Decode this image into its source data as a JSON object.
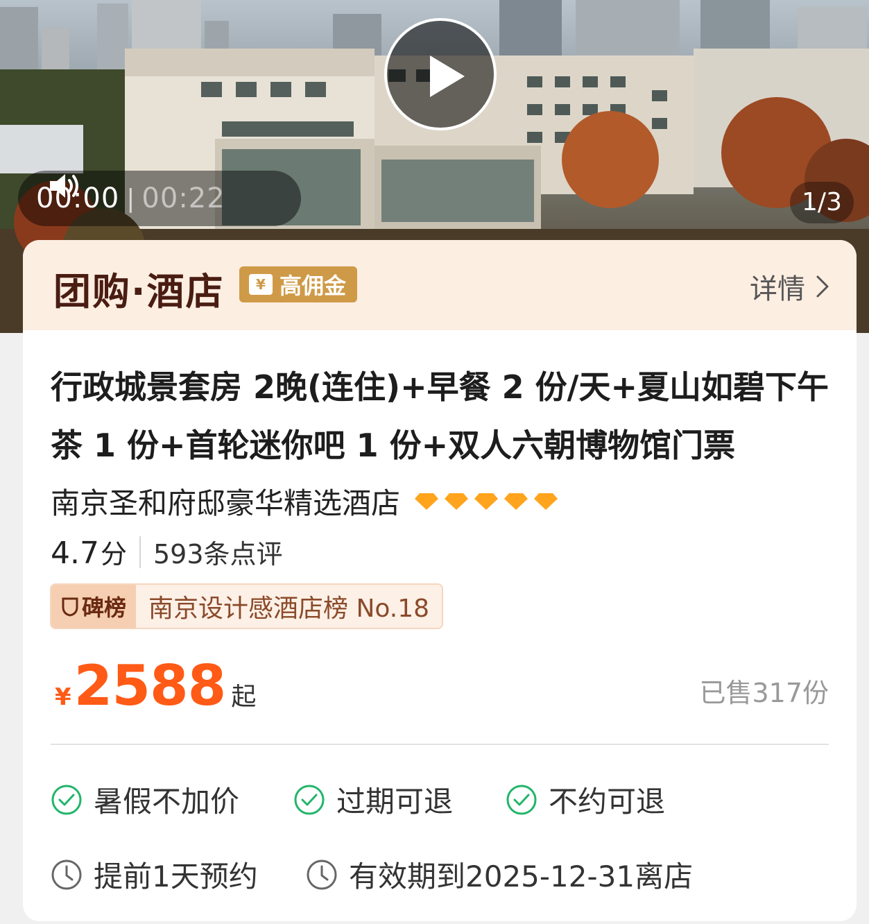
{
  "media": {
    "time_current": "00:00",
    "time_separator": "|",
    "time_total": "00:22",
    "page_indicator": "1/3"
  },
  "header": {
    "brand_title": "团购·酒店",
    "commission_badge": "高佣金",
    "commission_icon_text": "¥",
    "detail_label": "详情"
  },
  "product": {
    "title": "行政城景套房 2晚(连住)+早餐 2 份/天+夏山如碧下午茶 1 份+首轮迷你吧 1 份+双人六朝博物馆门票"
  },
  "hotel": {
    "name": "南京圣和府邸豪华精选酒店",
    "diamond_count": 5,
    "diamond_color": "#ffa41c"
  },
  "rating": {
    "score": "4.7",
    "score_unit": "分",
    "review_count": "593条点评"
  },
  "rank": {
    "tag": "碑榜",
    "text": "南京设计感酒店榜 No.18"
  },
  "price": {
    "symbol": "¥",
    "value": "2588",
    "suffix": "起",
    "sold": "已售317份",
    "color": "#ff5a16"
  },
  "features": [
    {
      "icon": "check-circle-icon",
      "label": "暑假不加价"
    },
    {
      "icon": "check-circle-icon",
      "label": "过期可退"
    },
    {
      "icon": "check-circle-icon",
      "label": "不约可退"
    },
    {
      "icon": "clock-icon",
      "label": "提前1天预约"
    },
    {
      "icon": "clock-icon",
      "label": "有效期到2025-12-31离店"
    }
  ],
  "colors": {
    "check_green": "#22b56a",
    "clock_gray": "#666666"
  }
}
